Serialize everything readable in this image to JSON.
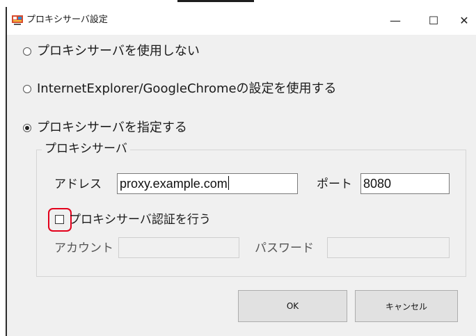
{
  "window": {
    "title": "プロキシサーバ設定",
    "controls": {
      "minimize": "—",
      "maximize": "☐",
      "close": "✕"
    }
  },
  "proxy_mode": {
    "options": [
      {
        "label": "プロキシサーバを使用しない",
        "selected": false
      },
      {
        "label": "InternetExplorer/GoogleChromeの設定を使用する",
        "selected": false
      },
      {
        "label": "プロキシサーバを指定する",
        "selected": true
      }
    ]
  },
  "proxy_group": {
    "legend": "プロキシサーバ",
    "address_label": "アドレス",
    "address_value": "proxy.example.com",
    "port_label": "ポート",
    "port_value": "8080",
    "auth_checkbox_label": "プロキシサーバ認証を行う",
    "auth_checked": false,
    "account_label": "アカウント",
    "account_value": "",
    "password_label": "パスワード",
    "password_value": ""
  },
  "buttons": {
    "ok": "OK",
    "cancel": "キャンセル"
  },
  "colors": {
    "highlight": "#e3001b",
    "client_bg": "#f0f0f0"
  }
}
